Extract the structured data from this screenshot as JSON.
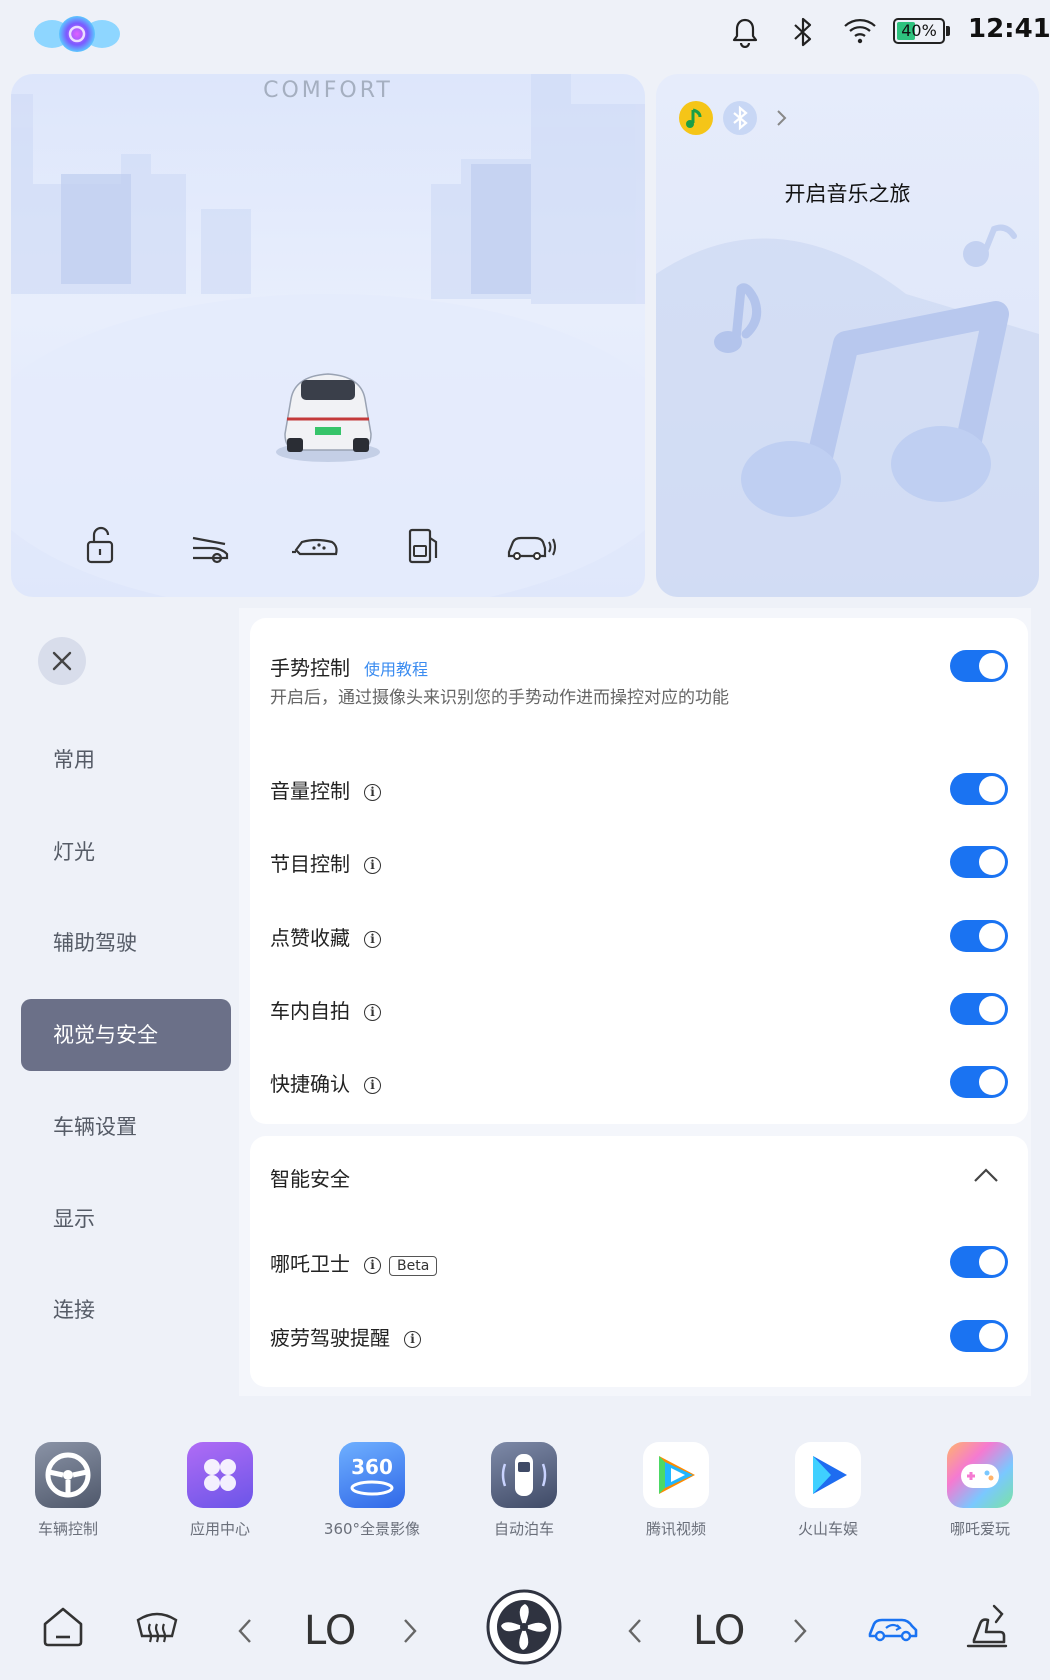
{
  "status_bar": {
    "time": "12:41",
    "battery_percent": "40%",
    "battery_level": 0.4,
    "icons": [
      "bell-icon",
      "bluetooth-icon",
      "wifi-icon",
      "battery-icon"
    ]
  },
  "car_card": {
    "mode": "COMFORT",
    "controls": [
      "unlock-icon",
      "trunk-icon",
      "headlight-icon",
      "fuel-door-icon",
      "find-car-icon"
    ]
  },
  "music_card": {
    "title": "开启音乐之旅",
    "sources": [
      "qq-music-icon",
      "bluetooth-music-icon"
    ]
  },
  "nav": {
    "items": [
      "常用",
      "灯光",
      "辅助驾驶",
      "视觉与安全",
      "车辆设置",
      "显示",
      "连接"
    ],
    "active": "视觉与安全"
  },
  "gesture_panel": {
    "title": "手势控制",
    "tutorial_link": "使用教程",
    "description": "开启后，通过摄像头来识别您的手势动作进而操控对应的功能",
    "rows": [
      {
        "label": "音量控制",
        "on": true
      },
      {
        "label": "节目控制",
        "on": true
      },
      {
        "label": "点赞收藏",
        "on": true
      },
      {
        "label": "车内自拍",
        "on": true
      },
      {
        "label": "快捷确认",
        "on": true
      }
    ],
    "gesture_on": true
  },
  "safety_panel": {
    "title": "智能安全",
    "rows": [
      {
        "label": "哪吒卫士",
        "badge": "Beta",
        "on": true
      },
      {
        "label": "疲劳驾驶提醒",
        "on": true
      }
    ]
  },
  "dock": {
    "apps": [
      {
        "label": "车辆控制",
        "icon": "steering-wheel-icon"
      },
      {
        "label": "应用中心",
        "icon": "app-grid-icon"
      },
      {
        "label": "360°全景影像",
        "icon": "camera-360-icon"
      },
      {
        "label": "自动泊车",
        "icon": "auto-parking-icon"
      },
      {
        "label": "腾讯视频",
        "icon": "tencent-video-icon"
      },
      {
        "label": "火山车娱",
        "icon": "volcano-play-icon"
      },
      {
        "label": "哪吒爱玩",
        "icon": "gamepad-icon"
      }
    ]
  },
  "bottom_bar": {
    "left_temp": "LO",
    "right_temp": "LO"
  },
  "colors": {
    "accent": "#1a73f2",
    "nav_active": "#6b7088",
    "battery": "#2ec27e"
  }
}
